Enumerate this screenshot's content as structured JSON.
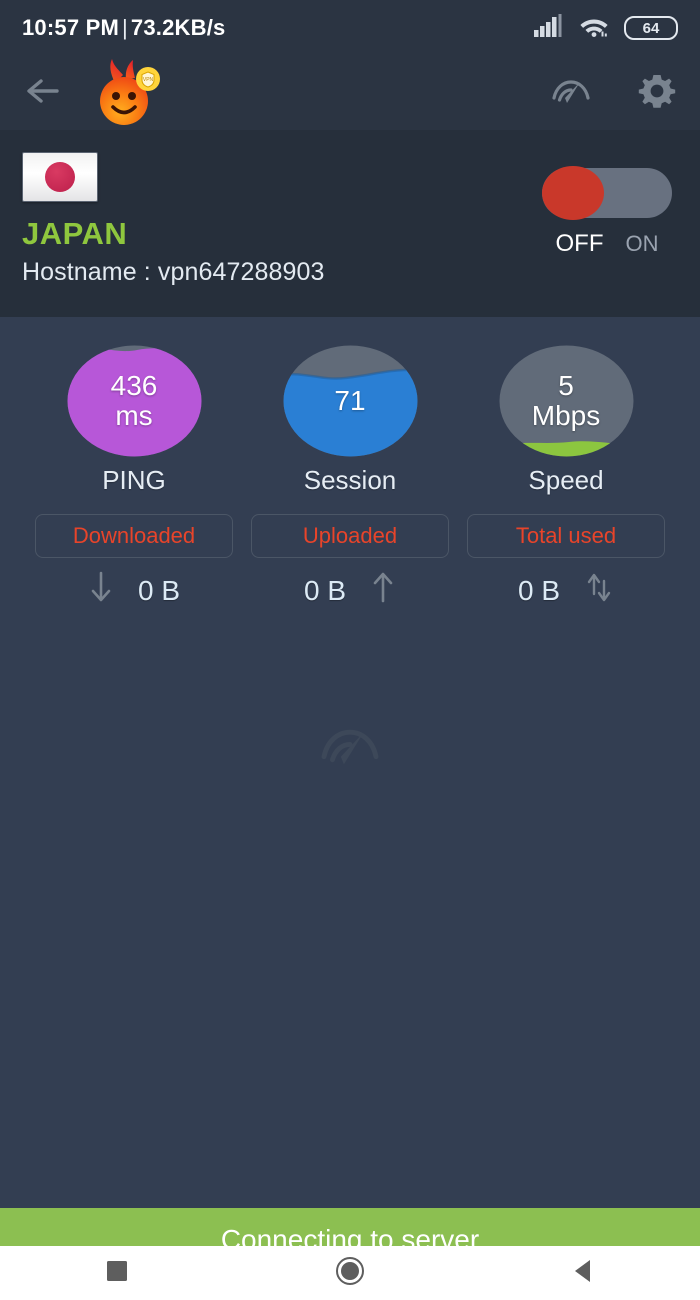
{
  "status_bar": {
    "time": "10:57 PM",
    "separator": "|",
    "network_speed": "73.2KB/s",
    "signal_icon": "signal-bars-icon",
    "wifi_icon": "wifi-icon",
    "battery_level": "64"
  },
  "app_bar": {
    "back_icon": "back-arrow-icon",
    "logo_icon": "hola-vpn-flame-smiley-logo",
    "speed_test_icon": "speedometer-icon",
    "settings_icon": "gear-icon"
  },
  "server_card": {
    "flag_icon": "japan-flag-icon",
    "country": "JAPAN",
    "hostname_label": "Hostname :",
    "hostname_value": "vpn647288903",
    "hostname_full": "Hostname : vpn647288903",
    "toggle": {
      "state": "OFF",
      "off_label": "OFF",
      "on_label": "ON",
      "knob_color": "#c9382a",
      "track_color": "#687180"
    },
    "country_color": "#8fc73e"
  },
  "stats": [
    {
      "value": "436",
      "unit": "ms",
      "label": "PING",
      "fill_percent": 100,
      "fill_color": "#b757d8",
      "track_color": "#616b79"
    },
    {
      "value": "71",
      "unit": "",
      "label": "Session",
      "fill_percent": 72,
      "fill_color": "#2a7fd4",
      "track_color": "#616b79"
    },
    {
      "value": "5",
      "unit": "Mbps",
      "label": "Speed",
      "fill_percent": 8,
      "fill_color": "#8cc63f",
      "track_color": "#616b79"
    }
  ],
  "usage": {
    "pill_color": "#e8442a",
    "items": [
      {
        "label": "Downloaded",
        "value": "0 B",
        "icon": "arrow-down-icon",
        "icon_side": "left"
      },
      {
        "label": "Uploaded",
        "value": "0 B",
        "icon": "arrow-up-icon",
        "icon_side": "right"
      },
      {
        "label": "Total used",
        "value": "0 B",
        "icon": "arrow-up-down-icon",
        "icon_side": "right"
      }
    ]
  },
  "watermark": {
    "icon": "speedometer-watermark-icon"
  },
  "banner": {
    "text": "Connecting to server",
    "background_color": "#8cbf51"
  },
  "nav_bar": {
    "recents_icon": "square-recents-icon",
    "home_icon": "circle-home-icon",
    "back_icon": "triangle-back-icon"
  }
}
